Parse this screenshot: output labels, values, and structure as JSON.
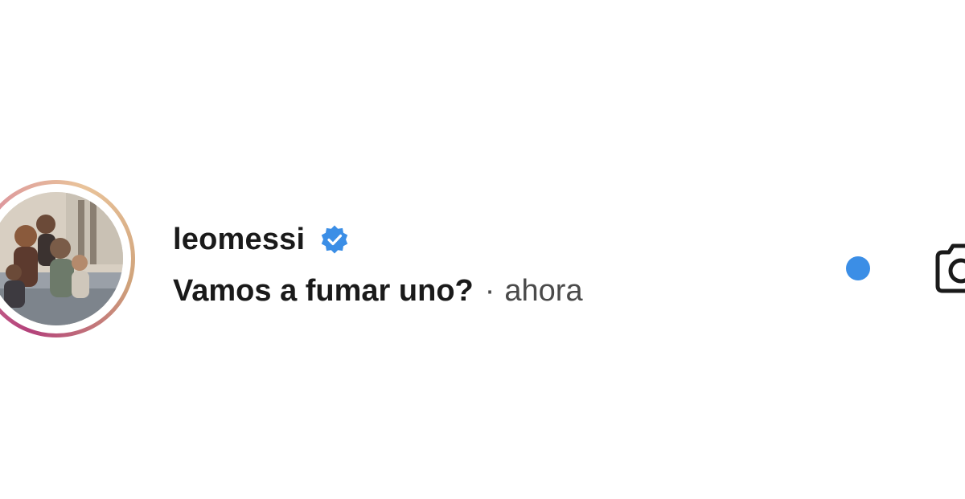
{
  "conversation": {
    "username": "leomessi",
    "verified": true,
    "verified_icon": "verified-badge-icon",
    "last_message": "Vamos a fumar uno?",
    "separator": "·",
    "timestamp": "ahora",
    "unread": true,
    "camera_icon": "camera-icon"
  },
  "colors": {
    "accent": "#3b8ee6",
    "text_primary": "#1a1a1a",
    "text_secondary": "#4a4a4a",
    "story_ring": "#b3417a"
  }
}
